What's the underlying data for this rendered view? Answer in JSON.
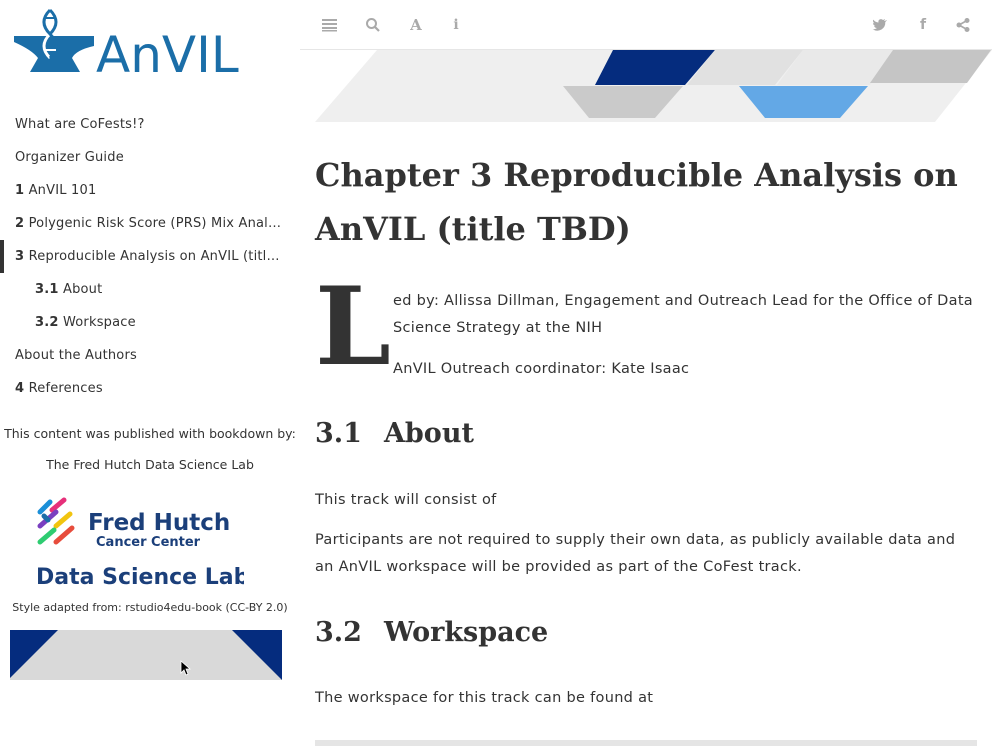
{
  "brand": {
    "name": "AnVIL"
  },
  "sidebar": {
    "toc": [
      {
        "num": "",
        "label": "What are CoFests!?"
      },
      {
        "num": "",
        "label": "Organizer Guide"
      },
      {
        "num": "1",
        "label": "AnVIL 101"
      },
      {
        "num": "2",
        "label": "Polygenic Risk Score (PRS) Mix Analysis…"
      },
      {
        "num": "3",
        "label": "Reproducible Analysis on AnVIL (title TBD)"
      },
      {
        "num": "3.1",
        "label": "About"
      },
      {
        "num": "3.2",
        "label": "Workspace"
      },
      {
        "num": "",
        "label": "About the Authors"
      },
      {
        "num": "4",
        "label": "References"
      }
    ],
    "published_with": "This content was published with bookdown by:",
    "publisher": "The Fred Hutch Data Science Lab",
    "fh_logo": {
      "line1": "Fred Hutch",
      "line2": "Cancer Center",
      "line3": "Data Science Lab"
    },
    "style_note": "Style adapted from: rstudio4edu-book (CC-BY 2.0)"
  },
  "topbar": {
    "icons": [
      "menu-icon",
      "search-icon",
      "font-icon",
      "info-icon",
      "twitter-icon",
      "facebook-icon",
      "share-icon"
    ]
  },
  "main": {
    "chapter_title": "Chapter 3   Reproducible Analysis on AnVIL (title TBD)",
    "dropcap": "L",
    "led_by": "ed by: Allissa Dillman, Engagement and Outreach Lead for the Office of Data Science Strategy at the NIH",
    "coordinator": "AnVIL Outreach coordinator: Kate Isaac",
    "sections": [
      {
        "num": "3.1",
        "title": "About"
      },
      {
        "num": "3.2",
        "title": "Workspace"
      }
    ],
    "about_p1": "This track will consist of",
    "about_p2": "Participants are not required to supply their own data, as publicly available data and an AnVIL workspace will be provided as part of the CoFest track.",
    "workspace_p1": "The workspace for this track can be found at"
  },
  "colors": {
    "brand_blue": "#1b6ea8",
    "navy": "#052c7e",
    "light_blue": "#63a8e6",
    "gray": "#d9d9d9",
    "text": "#333333"
  }
}
